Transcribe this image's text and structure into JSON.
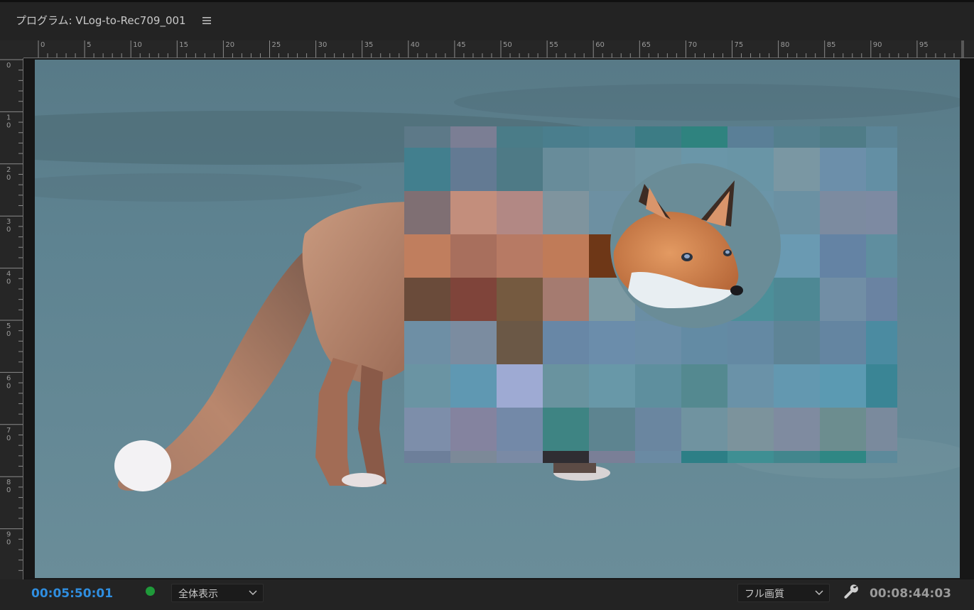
{
  "panel": {
    "title": "プログラム: VLog-to-Rec709_001",
    "menu_icon": "hamburger-menu-icon"
  },
  "ruler": {
    "horizontal_labels": [
      "0",
      "5",
      "10",
      "15",
      "20",
      "25",
      "30",
      "35",
      "40",
      "45",
      "50",
      "55",
      "60",
      "65",
      "70",
      "75",
      "80",
      "85",
      "90",
      "95"
    ],
    "vertical_labels": [
      [
        "0"
      ],
      [
        "1",
        "0"
      ],
      [
        "2",
        "0"
      ],
      [
        "3",
        "0"
      ],
      [
        "4",
        "0"
      ],
      [
        "5",
        "0"
      ],
      [
        "6",
        "0"
      ],
      [
        "7",
        "0"
      ],
      [
        "8",
        "0"
      ],
      [
        "9",
        "0"
      ]
    ]
  },
  "footer": {
    "current_timecode": "00:05:50:01",
    "status_color": "#1f9a3a",
    "zoom_select": "全体表示",
    "quality_select": "フル画質",
    "settings_icon": "wrench-icon",
    "duration_timecode": "00:08:44:03"
  },
  "colors": {
    "accent_timecode": "#2f8ee0",
    "panel_bg": "#232323"
  }
}
